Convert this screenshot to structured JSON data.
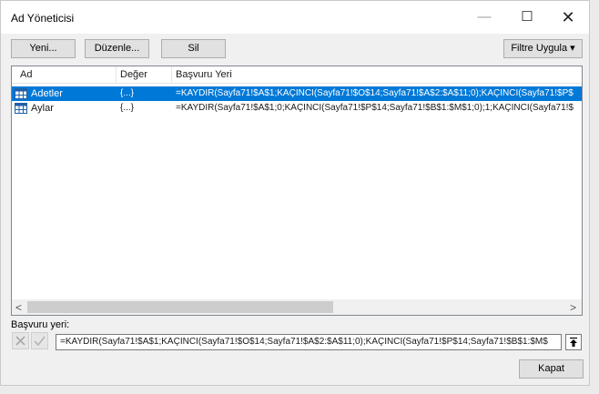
{
  "window": {
    "title": "Ad Yöneticisi",
    "minimize_glyph": "—",
    "maximize_glyph": "☐",
    "close_glyph": "✕"
  },
  "toolbar": {
    "new_label": "Yeni...",
    "edit_label": "Düzenle...",
    "delete_label": "Sil",
    "filter_label": "Filtre Uygula",
    "filter_arrow": "▾"
  },
  "list": {
    "columns": [
      "Ad",
      "Değer",
      "Başvuru Yeri"
    ],
    "rows": [
      {
        "name": "Adetler",
        "value": "{...}",
        "refers_to": "=KAYDIR(Sayfa71!$A$1;KAÇINCI(Sayfa71!$O$14;Sayfa71!$A$2:$A$11;0);KAÇINCI(Sayfa71!$P$",
        "selected": true
      },
      {
        "name": "Aylar",
        "value": "{...}",
        "refers_to": "=KAYDIR(Sayfa71!$A$1;0;KAÇINCI(Sayfa71!$P$14;Sayfa71!$B$1:$M$1;0);1;KAÇINCI(Sayfa71!$",
        "selected": false
      }
    ]
  },
  "scrollbar": {
    "left_glyph": "<",
    "right_glyph": ">"
  },
  "refers_to": {
    "label": "Başvuru yeri:",
    "value": "=KAYDIR(Sayfa71!$A$1;KAÇINCI(Sayfa71!$O$14;Sayfa71!$A$2:$A$11;0);KAÇINCI(Sayfa71!$P$14;Sayfa71!$B$1:$M$"
  },
  "footer": {
    "close_label": "Kapat"
  },
  "colors": {
    "selection": "#0078d7",
    "table_icon": "#1f5fa8"
  }
}
